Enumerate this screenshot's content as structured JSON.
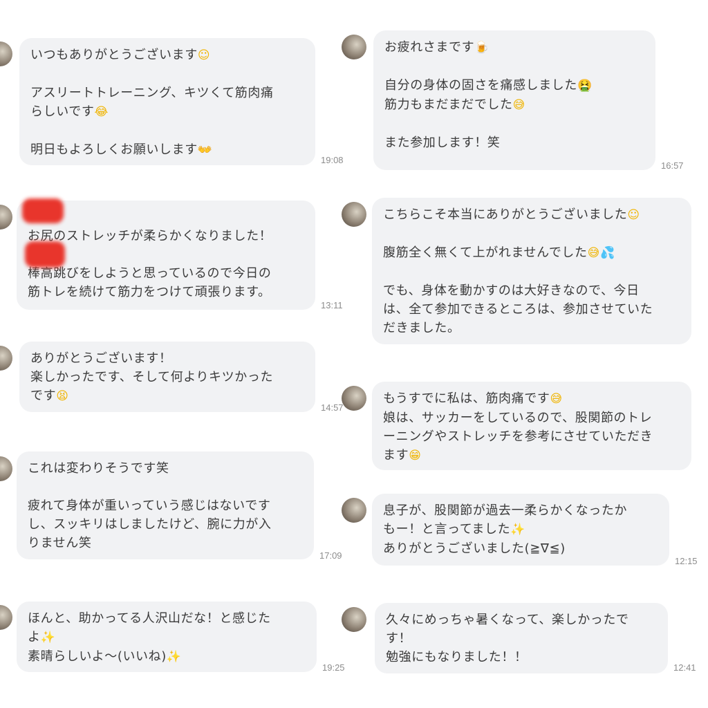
{
  "left": [
    {
      "lines": [
        {
          "t": "いつもありがとうございます",
          "e": "☺",
          "ec": "emoji"
        },
        {
          "blank": true
        },
        {
          "t": "アスリートトレーニング、キツくて筋肉痛"
        },
        {
          "t": "らしいです",
          "e": "😂",
          "ec": "emoji"
        },
        {
          "blank": true
        },
        {
          "t": "明日もよろしくお願いします",
          "e": "👐",
          "ec": "emoji"
        }
      ],
      "time": "19:08"
    },
    {
      "lines": [
        {
          "blank": true
        },
        {
          "t": "お尻のストレッチが柔らかくなりました！"
        },
        {
          "blank": true
        },
        {
          "t": "棒高跳びをしようと思っているので今日の"
        },
        {
          "t": "筋トレを続けて筋力をつけて頑張ります。"
        }
      ],
      "time": "13:11"
    },
    {
      "lines": [
        {
          "t": "ありがとうございます！"
        },
        {
          "t": "楽しかったです、そして何よりキツかった"
        },
        {
          "t": "です",
          "e": "😫",
          "ec": "emoji"
        }
      ],
      "time": "14:57"
    },
    {
      "lines": [
        {
          "t": "これは変わりそうです笑"
        },
        {
          "blank": true
        },
        {
          "t": "疲れて身体が重いっていう感じはないです"
        },
        {
          "t": "し、スッキリはしましたけど、腕に力が入"
        },
        {
          "t": "りません笑"
        }
      ],
      "time": "17:09"
    },
    {
      "lines": [
        {
          "t": "ほんと、助かってる人沢山だな！と感じた"
        },
        {
          "t": "よ",
          "e": "✨",
          "ec": "emoji sparkle"
        },
        {
          "t": "素晴らしいよ〜(いいね)",
          "e": "✨",
          "ec": "emoji sparkle"
        }
      ],
      "time": "19:25"
    }
  ],
  "right": [
    {
      "lines": [
        {
          "t": "お疲れさまです",
          "e": "🍺",
          "ec": "emoji beer"
        },
        {
          "blank": true
        },
        {
          "t": "自分の身体の固さを痛感しました",
          "e": "🤮",
          "ec": "emoji green"
        },
        {
          "t": "筋力もまだまだでした",
          "e": "😅",
          "ec": "emoji"
        },
        {
          "blank": true
        },
        {
          "t": "また参加します！笑"
        }
      ],
      "time": "16:57"
    },
    {
      "lines": [
        {
          "t": "こちらこそ本当にありがとうございました",
          "e": "☺",
          "ec": "emoji"
        },
        {
          "blank": true
        },
        {
          "t": "腹筋全く無くて上がれませんでした",
          "e": "😅💦",
          "ec": "emoji"
        },
        {
          "blank": true
        },
        {
          "t": "でも、身体を動かすのは大好きなので、今日"
        },
        {
          "t": "は、全て参加できるところは、参加させていた"
        },
        {
          "t": "だきました。"
        }
      ],
      "time": ""
    },
    {
      "lines": [
        {
          "t": "もうすでに私は、筋肉痛です",
          "e": "😅",
          "ec": "emoji"
        },
        {
          "t": "娘は、サッカーをしているので、股関節のトレ"
        },
        {
          "t": "ーニングやストレッチを参考にさせていただき"
        },
        {
          "t": "ます",
          "e": "😁",
          "ec": "emoji"
        }
      ],
      "time": ""
    },
    {
      "lines": [
        {
          "t": "息子が、股関節が過去一柔らかくなったか"
        },
        {
          "t": "もー！と言ってました",
          "e": "✨",
          "ec": "emoji sparkle"
        },
        {
          "t": "ありがとうございました(≧∇≦)"
        }
      ],
      "time": "12:15"
    },
    {
      "lines": [
        {
          "t": "久々にめっちゃ暑くなって、楽しかったで"
        },
        {
          "t": "す！"
        },
        {
          "t": "勉強にもなりました！！"
        }
      ],
      "time": "12:41"
    }
  ]
}
